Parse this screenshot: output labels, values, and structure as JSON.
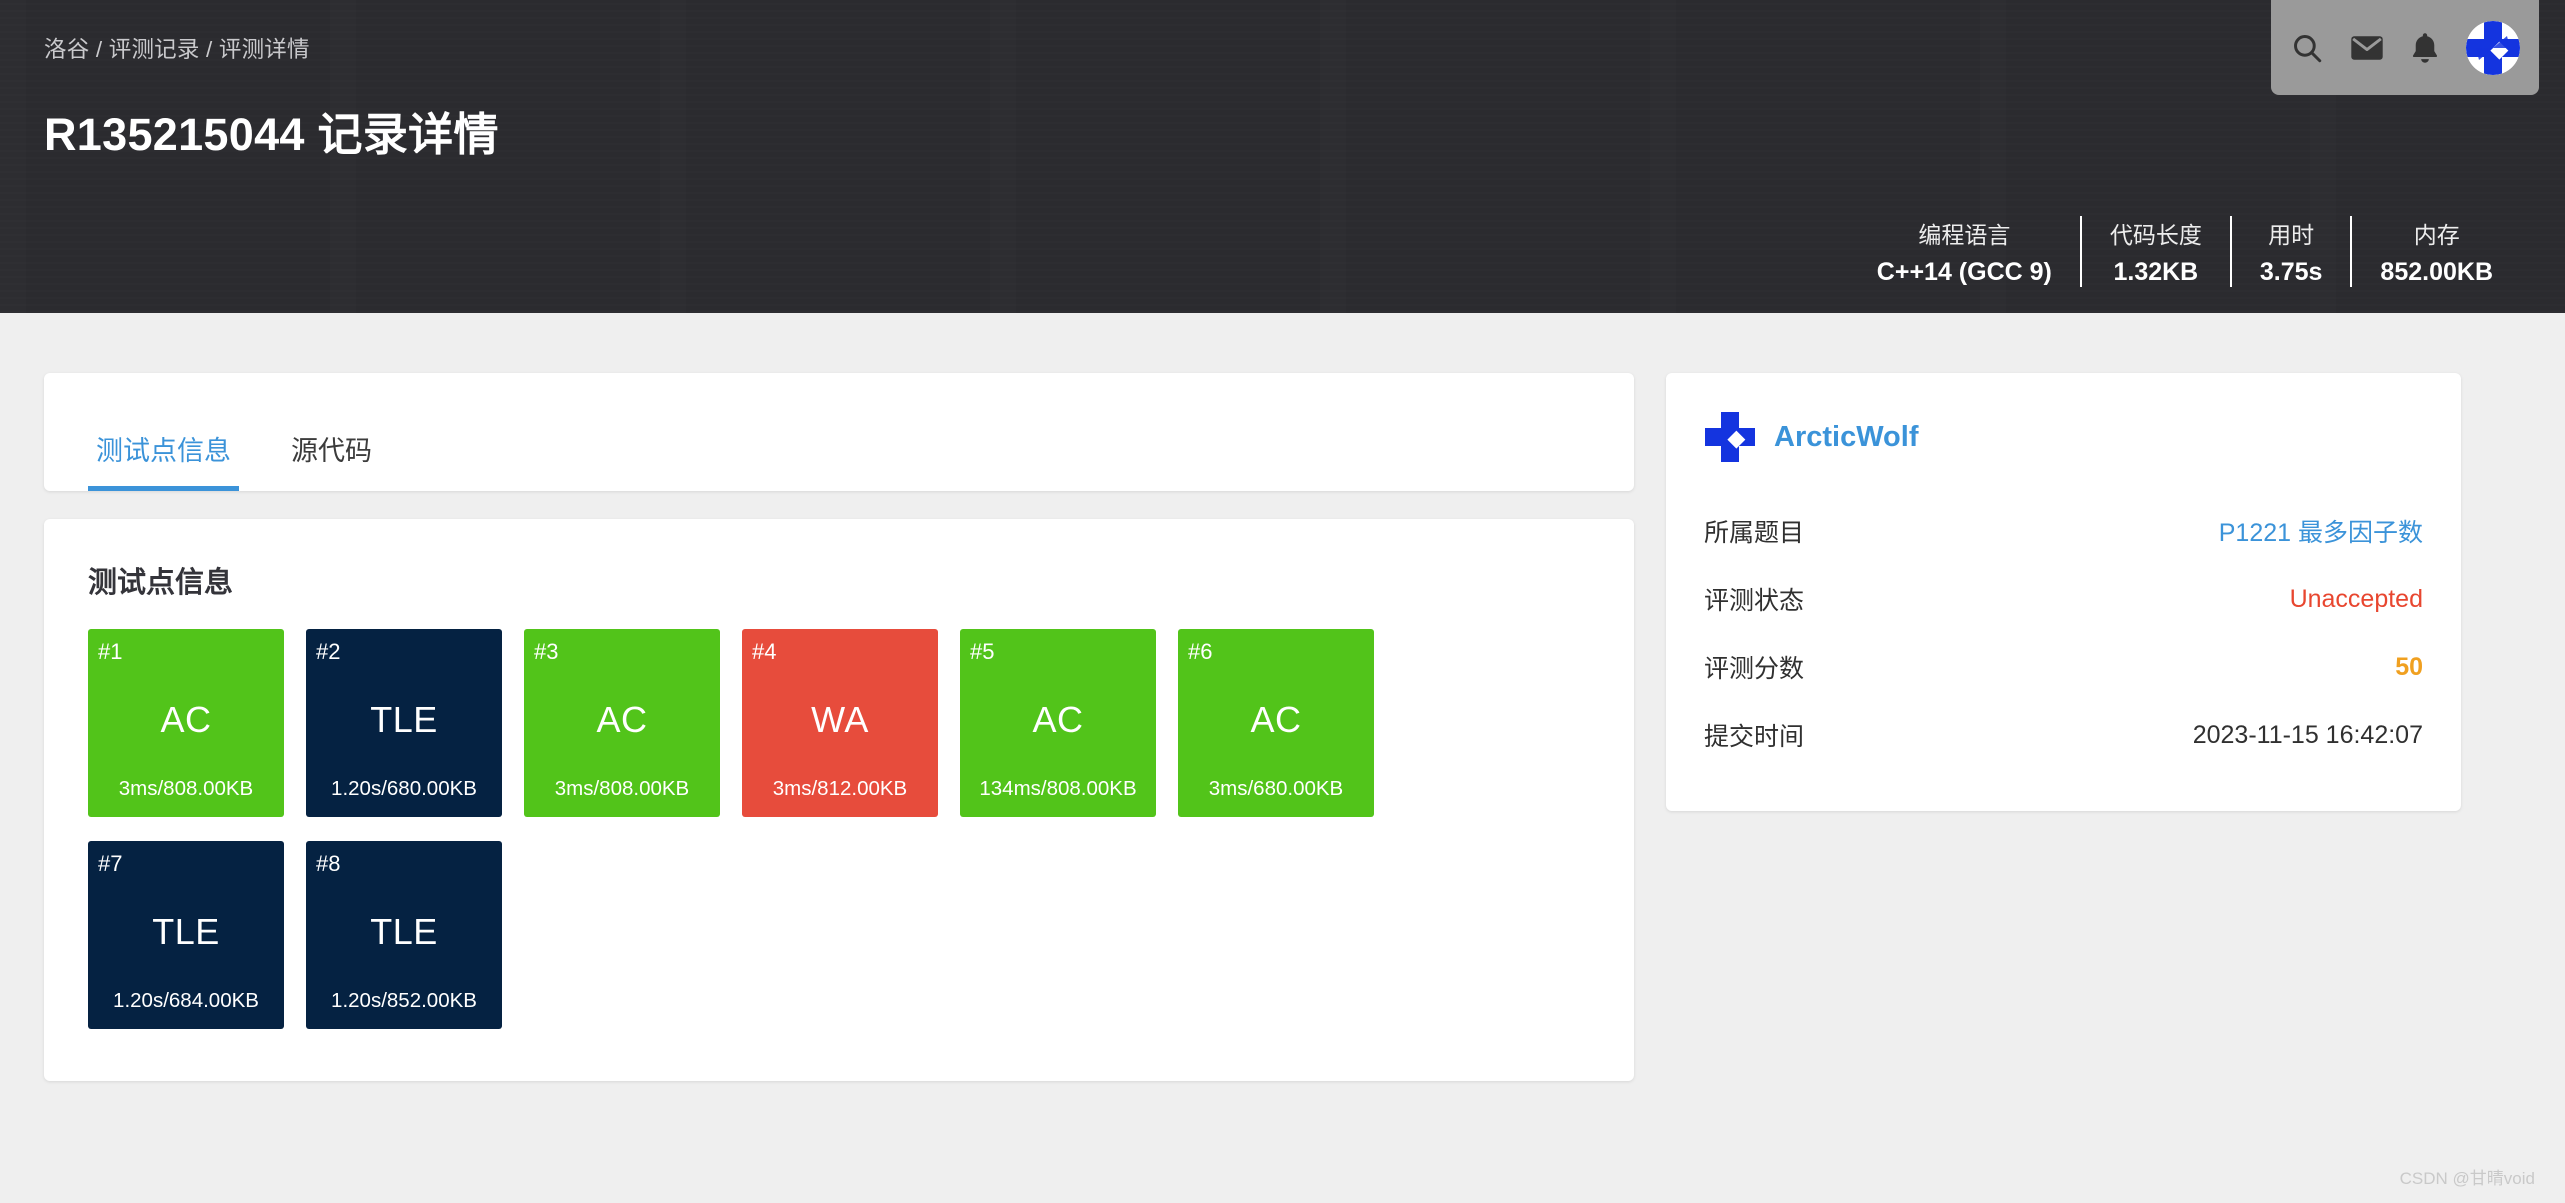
{
  "header": {
    "breadcrumb": "洛谷 / 评测记录 / 评测详情",
    "title": "R135215044 记录详情",
    "icons": {
      "search": "search-icon",
      "mail": "mail-icon",
      "bell": "bell-icon",
      "avatar": "user-avatar-icon"
    },
    "stats": [
      {
        "label": "编程语言",
        "value": "C++14 (GCC 9)"
      },
      {
        "label": "代码长度",
        "value": "1.32KB"
      },
      {
        "label": "用时",
        "value": "3.75s"
      },
      {
        "label": "内存",
        "value": "852.00KB"
      }
    ]
  },
  "tabs": [
    {
      "label": "测试点信息",
      "active": true
    },
    {
      "label": "源代码",
      "active": false
    }
  ],
  "testpoints": {
    "section_title": "测试点信息",
    "items": [
      {
        "id": "#1",
        "status": "AC",
        "metrics": "3ms/808.00KB",
        "kind": "ac"
      },
      {
        "id": "#2",
        "status": "TLE",
        "metrics": "1.20s/680.00KB",
        "kind": "tle"
      },
      {
        "id": "#3",
        "status": "AC",
        "metrics": "3ms/808.00KB",
        "kind": "ac"
      },
      {
        "id": "#4",
        "status": "WA",
        "metrics": "3ms/812.00KB",
        "kind": "wa"
      },
      {
        "id": "#5",
        "status": "AC",
        "metrics": "134ms/808.00KB",
        "kind": "ac"
      },
      {
        "id": "#6",
        "status": "AC",
        "metrics": "3ms/680.00KB",
        "kind": "ac"
      },
      {
        "id": "#7",
        "status": "TLE",
        "metrics": "1.20s/684.00KB",
        "kind": "tle"
      },
      {
        "id": "#8",
        "status": "TLE",
        "metrics": "1.20s/852.00KB",
        "kind": "tle"
      }
    ]
  },
  "sidebar": {
    "user": "ArcticWolf",
    "rows": [
      {
        "label": "所属题目",
        "value": "P1221 最多因子数",
        "style": "link"
      },
      {
        "label": "评测状态",
        "value": "Unaccepted",
        "style": "status"
      },
      {
        "label": "评测分数",
        "value": "50",
        "style": "score"
      },
      {
        "label": "提交时间",
        "value": "2023-11-15 16:42:07",
        "style": "plain"
      }
    ]
  },
  "watermark": "CSDN @甘晴void",
  "colors": {
    "accent_blue": "#3b93d9",
    "ac_green": "#52c41a",
    "wa_red": "#e74c3c",
    "tle_navy": "#052242",
    "status_red": "#e8462f",
    "score_orange": "#f0a020",
    "header_dark": "#2b2b2f"
  }
}
